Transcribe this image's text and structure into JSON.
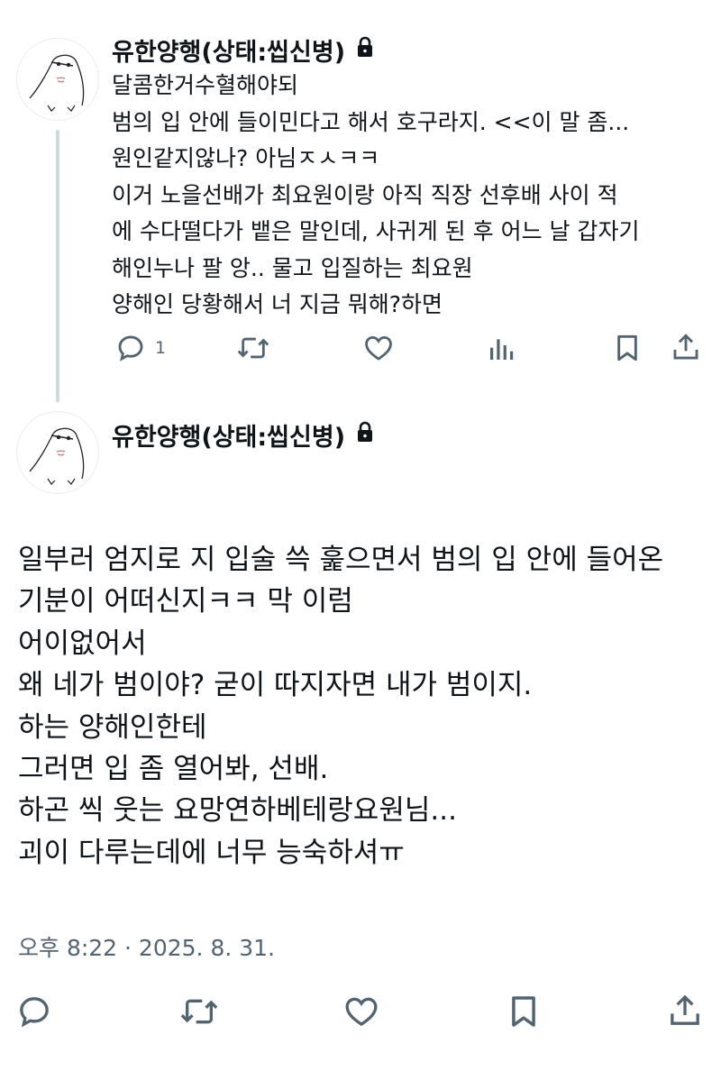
{
  "tweets": [
    {
      "author": "유한양행(상태:씹신병)",
      "lines": [
        "달콤한거수혈해야되",
        "범의 입 안에 들이민다고 해서 호구라지. <<이 말 좀...",
        "원인같지않나? 아님ㅈㅅㅋㅋ",
        "이거 노을선배가 최요원이랑 아직 직장 선후배 사이 적",
        "에 수다떨다가 뱉은 말인데, 사귀게 된 후 어느 날 갑자기",
        "해인누나 팔 앙.. 물고 입질하는 최요원",
        "양해인 당황해서 너 지금 뭐해?하면"
      ],
      "reply_count": "1"
    },
    {
      "author": "유한양행(상태:씹신병)",
      "lines": [
        "일부러 엄지로 지 입술 쓱 훑으면서 범의 입 안에 들어온",
        "기분이 어떠신지ㅋㅋ 막 이럼",
        "어이없어서",
        "왜 네가 범이야? 굳이 따지자면 내가 범이지.",
        "하는 양해인한테",
        "그러면 입 좀 열어봐, 선배.",
        "하곤 씩 웃는 요망연하베테랑요원님...",
        "괴이 다루는데에 너무 능숙하셔ㅠ"
      ],
      "timestamp": "오후 8:22 · 2025. 8. 31."
    }
  ],
  "icons": {
    "reply": "reply-icon",
    "retweet": "retweet-icon",
    "like": "heart-icon",
    "views": "views-icon",
    "bookmark": "bookmark-icon",
    "share": "share-icon",
    "lock": "lock-icon"
  },
  "colors": {
    "text": "#0f1419",
    "secondary": "#536471",
    "thread_line": "#cfd9de"
  }
}
